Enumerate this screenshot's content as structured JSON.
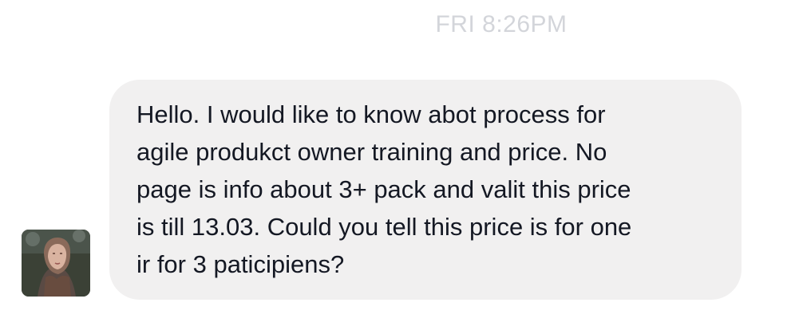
{
  "conversation": {
    "timestamp": "FRI 8:26PM",
    "messages": [
      {
        "direction": "incoming",
        "avatar_icon": "user-avatar-photo",
        "text": "Hello. I would like to know abot process for\nagile produkct owner training and price. No\npage is info about 3+ pack and valit this price\nis till 13.03. Could you tell this price is for one\nir for 3 paticipiens?"
      }
    ]
  },
  "colors": {
    "bubble_background": "#f1f0f0",
    "message_text": "#141823",
    "timestamp_text": "#d3d5da",
    "background": "#ffffff"
  }
}
